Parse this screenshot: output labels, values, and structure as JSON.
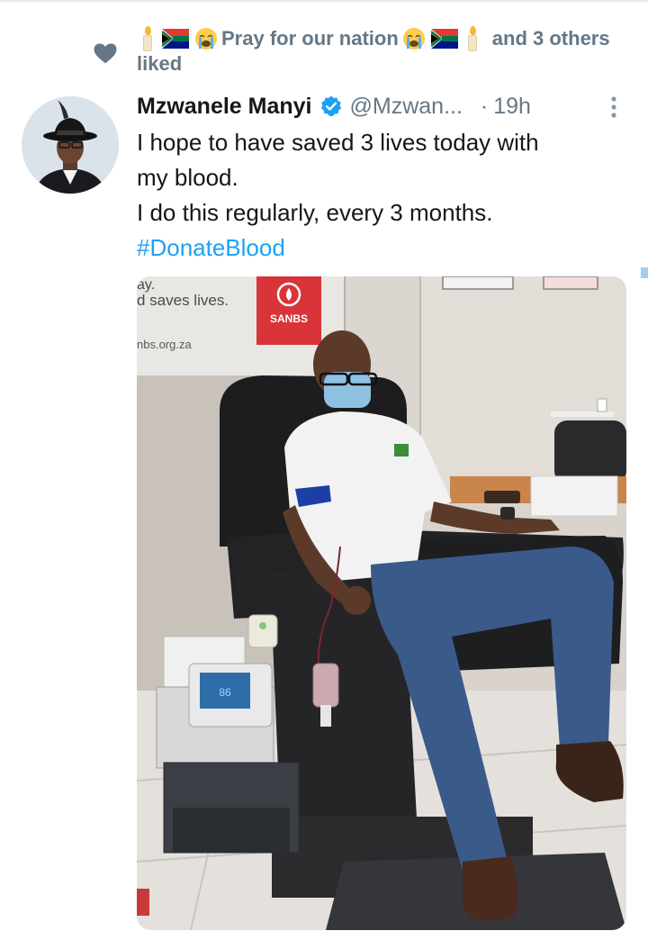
{
  "social_context": {
    "group_name": "Pray for our nation",
    "others_text": "and 3 others",
    "action_text": "liked",
    "icons": [
      "candle-emoji",
      "south-africa-flag-emoji",
      "crying-face-emoji",
      "heart-icon"
    ]
  },
  "tweet": {
    "author_name": "Mzwanele Manyi",
    "handle": "@Mzwan...",
    "separator": "·",
    "time": "19h",
    "verified": true,
    "text_lines": [
      "I hope to have saved 3 lives today with",
      "my blood.",
      "I do this regularly, every 3 months."
    ],
    "hashtag": "#DonateBlood"
  },
  "photo": {
    "poster_text_top": "ay.",
    "poster_text_line": "d saves lives.",
    "poster_url": "nbs.org.za",
    "logo_text": "SANBS",
    "monitor_reading": "86"
  },
  "colors": {
    "accent": "#1da1f2",
    "muted": "#657786",
    "text": "#14171a",
    "sanbs_red": "#d9343a"
  }
}
